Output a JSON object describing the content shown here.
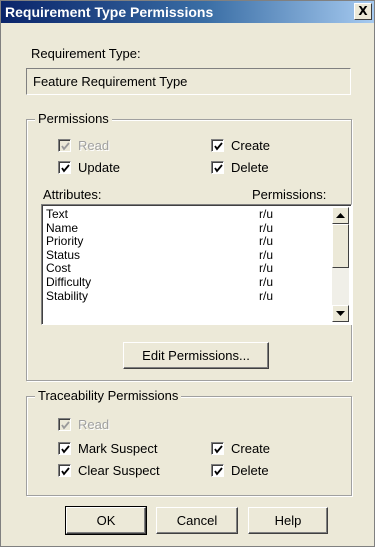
{
  "window": {
    "title": "Requirement Type Permissions",
    "close_glyph": "X"
  },
  "requirement_type": {
    "label": "Requirement Type:",
    "value": "Feature Requirement Type"
  },
  "permissions": {
    "group_label": "Permissions",
    "checkboxes": {
      "read": {
        "label": "Read",
        "checked": true,
        "enabled": false
      },
      "create": {
        "label": "Create",
        "checked": true,
        "enabled": true
      },
      "update": {
        "label": "Update",
        "checked": true,
        "enabled": true
      },
      "delete": {
        "label": "Delete",
        "checked": true,
        "enabled": true
      }
    },
    "attributes_header": "Attributes:",
    "permissions_header": "Permissions:",
    "attributes": [
      {
        "name": "Text",
        "perm": "r/u"
      },
      {
        "name": "Name",
        "perm": "r/u"
      },
      {
        "name": "Priority",
        "perm": "r/u"
      },
      {
        "name": "Status",
        "perm": "r/u"
      },
      {
        "name": "Cost",
        "perm": "r/u"
      },
      {
        "name": "Difficulty",
        "perm": "r/u"
      },
      {
        "name": "Stability",
        "perm": "r/u"
      }
    ],
    "edit_button": "Edit Permissions..."
  },
  "traceability": {
    "group_label": "Traceability Permissions",
    "checkboxes": {
      "read": {
        "label": "Read",
        "checked": true,
        "enabled": false
      },
      "mark_suspect": {
        "label": "Mark Suspect",
        "checked": true,
        "enabled": true
      },
      "create": {
        "label": "Create",
        "checked": true,
        "enabled": true
      },
      "clear_suspect": {
        "label": "Clear Suspect",
        "checked": true,
        "enabled": true
      },
      "delete": {
        "label": "Delete",
        "checked": true,
        "enabled": true
      }
    }
  },
  "buttons": {
    "ok": "OK",
    "cancel": "Cancel",
    "help": "Help"
  }
}
